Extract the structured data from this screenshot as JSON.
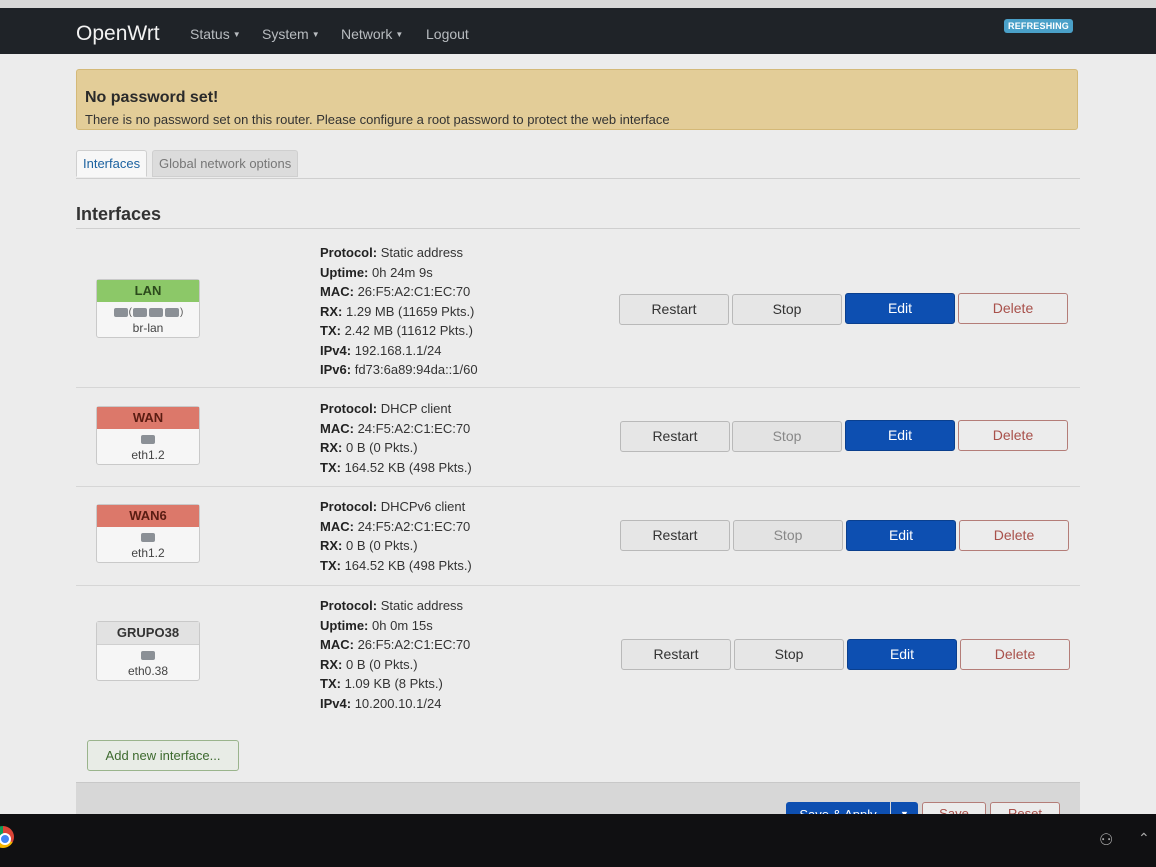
{
  "navbar": {
    "brand": "OpenWrt",
    "menu": [
      {
        "label": "Status"
      },
      {
        "label": "System"
      },
      {
        "label": "Network"
      },
      {
        "label": "Logout"
      }
    ],
    "status_badge": "REFRESHING"
  },
  "alert": {
    "title": "No password set!",
    "message": "There is no password set on this router. Please configure a root password to protect the web interface"
  },
  "tabs": [
    "Interfaces",
    "Global network options"
  ],
  "section_title": "Interfaces",
  "interfaces": [
    {
      "name": "LAN",
      "device": "br-lan",
      "color": "#8cc868",
      "details": [
        {
          "label": "Protocol:",
          "value": "Static address"
        },
        {
          "label": "Uptime:",
          "value": "0h 24m 9s"
        },
        {
          "label": "MAC:",
          "value": "26:F5:A2:C1:EC:70"
        },
        {
          "label": "RX:",
          "value": "1.29 MB (11659 Pkts.)"
        },
        {
          "label": "TX:",
          "value": "2.42 MB (11612 Pkts.)"
        },
        {
          "label": "IPv4:",
          "value": "192.168.1.1/24"
        },
        {
          "label": "IPv6:",
          "value": "fd73:6a89:94da::1/60"
        }
      ]
    },
    {
      "name": "WAN",
      "device": "eth1.2",
      "color": "#dc786a",
      "details": [
        {
          "label": "Protocol:",
          "value": "DHCP client"
        },
        {
          "label": "MAC:",
          "value": "24:F5:A2:C1:EC:70"
        },
        {
          "label": "RX:",
          "value": "0 B (0 Pkts.)"
        },
        {
          "label": "TX:",
          "value": "164.52 KB (498 Pkts.)"
        }
      ]
    },
    {
      "name": "WAN6",
      "device": "eth1.2",
      "color": "#dc786a",
      "details": [
        {
          "label": "Protocol:",
          "value": "DHCPv6 client"
        },
        {
          "label": "MAC:",
          "value": "24:F5:A2:C1:EC:70"
        },
        {
          "label": "RX:",
          "value": "0 B (0 Pkts.)"
        },
        {
          "label": "TX:",
          "value": "164.52 KB (498 Pkts.)"
        }
      ]
    },
    {
      "name": "GRUPO38",
      "device": "eth0.38",
      "color": "#e2e2e2",
      "details": [
        {
          "label": "Protocol:",
          "value": "Static address"
        },
        {
          "label": "Uptime:",
          "value": "0h 0m 15s"
        },
        {
          "label": "MAC:",
          "value": "26:F5:A2:C1:EC:70"
        },
        {
          "label": "RX:",
          "value": "0 B (0 Pkts.)"
        },
        {
          "label": "TX:",
          "value": "1.09 KB (8 Pkts.)"
        },
        {
          "label": "IPv4:",
          "value": "10.200.10.1/24"
        }
      ]
    }
  ],
  "row_actions": {
    "restart": "Restart",
    "stop": "Stop",
    "edit": "Edit",
    "delete": "Delete"
  },
  "add_interface": "Add new interface...",
  "footer": {
    "save_apply": "Save & Apply",
    "save": "Save",
    "reset": "Reset"
  }
}
